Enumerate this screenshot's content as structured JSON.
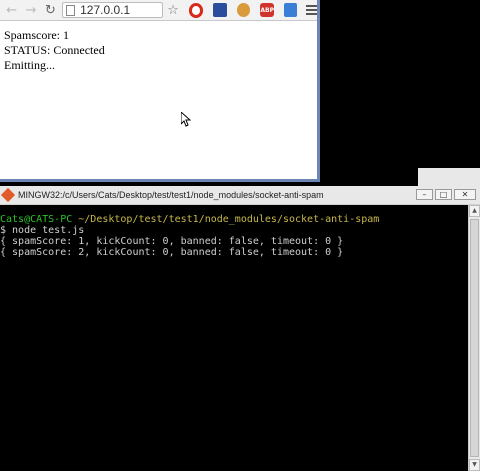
{
  "browser": {
    "url": "127.0.0.1",
    "lines": [
      "Spamscore: 1",
      "STATUS: Connected",
      "Emitting..."
    ],
    "extensions": [
      "opera-icon",
      "blue-ext-icon",
      "cookie-icon",
      "abp-icon",
      "lock-icon"
    ],
    "abp_label": "ABP"
  },
  "terminal": {
    "title": "MINGW32:/c/Users/Cats/Desktop/test/test1/node_modules/socket-anti-spam",
    "prompt_user": "Cats@CATS-PC",
    "prompt_path": " ~/Desktop/test/test1/node_modules/socket-anti-spam",
    "lines": [
      "$ node test.js",
      "{ spamScore: 1, kickCount: 0, banned: false, timeout: 0 }",
      "{ spamScore: 2, kickCount: 0, banned: false, timeout: 0 }"
    ]
  },
  "colors": {
    "prompt_user": "#2bc32b",
    "prompt_path": "#c8b84a",
    "browser_border": "#6b86b4"
  }
}
